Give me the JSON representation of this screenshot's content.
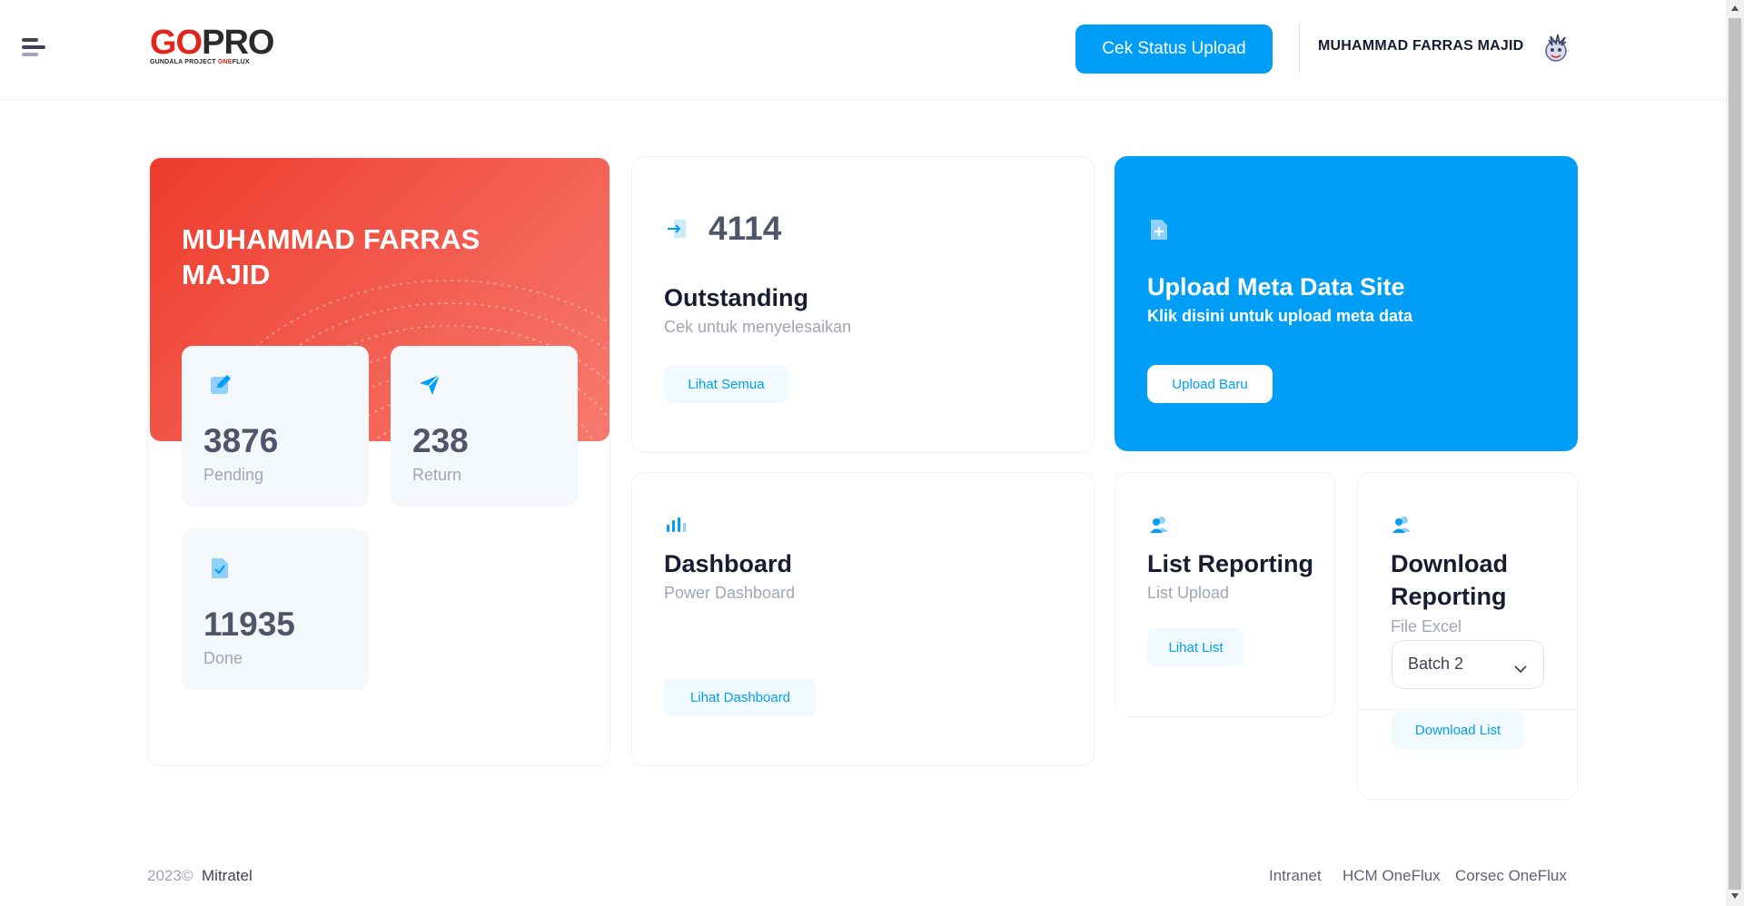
{
  "header": {
    "logo": {
      "main_red": "GO",
      "main_dark": "PRO",
      "sub_prefix": "GUNDALA PROJECT ",
      "sub_red": "ONE",
      "sub_suffix": "FLUX"
    },
    "status_button": "Cek Status Upload",
    "user_name": "MUHAMMAD FARRAS MAJID"
  },
  "profile_card": {
    "name": "MUHAMMAD FARRAS MAJID",
    "stats": [
      {
        "value": "3876",
        "label": "Pending",
        "icon": "edit-icon"
      },
      {
        "value": "238",
        "label": "Return",
        "icon": "send-icon"
      },
      {
        "value": "11935",
        "label": "Done",
        "icon": "file-check-icon"
      }
    ]
  },
  "outstanding": {
    "count": "4114",
    "title": "Outstanding",
    "subtitle": "Cek untuk menyelesaikan",
    "button": "Lihat Semua"
  },
  "upload": {
    "title": "Upload Meta Data Site",
    "subtitle": "Klik disini untuk upload meta data",
    "button": "Upload Baru"
  },
  "dashboard": {
    "title": "Dashboard",
    "subtitle": "Power Dashboard",
    "button": "Lihat Dashboard"
  },
  "list_reporting": {
    "title": "List Reporting",
    "subtitle": "List Upload",
    "button": "Lihat List"
  },
  "download_reporting": {
    "title_line1": "Download",
    "title_line2": "Reporting",
    "subtitle": "File Excel",
    "select_value": "Batch 2",
    "button": "Download List"
  },
  "footer": {
    "year": "2023©",
    "brand": "Mitratel",
    "links": [
      "Intranet",
      "HCM OneFlux",
      "Corsec OneFlux"
    ]
  },
  "colors": {
    "primary": "#009ef7",
    "danger": "#ee3b2c",
    "dark": "#181c32",
    "muted": "#a1a5b7"
  }
}
